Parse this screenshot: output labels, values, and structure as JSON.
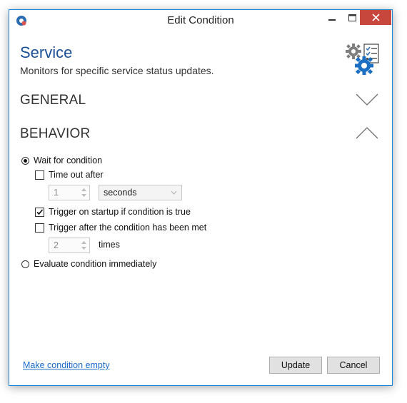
{
  "window": {
    "title": "Edit Condition"
  },
  "header": {
    "title": "Service",
    "subtitle": "Monitors for specific service status updates."
  },
  "sections": {
    "general": "GENERAL",
    "behavior": "BEHAVIOR"
  },
  "behavior": {
    "wait_for_condition": {
      "label": "Wait for condition",
      "selected": true
    },
    "time_out_after": {
      "label": "Time out after",
      "checked": false,
      "value": "1",
      "unit": "seconds"
    },
    "trigger_on_startup": {
      "label": "Trigger on startup if condition is true",
      "checked": true
    },
    "trigger_after_met": {
      "label": "Trigger after the condition has been met",
      "checked": false,
      "value": "2",
      "unit_label": "times"
    },
    "evaluate_immediately": {
      "label": "Evaluate condition immediately",
      "selected": false
    }
  },
  "footer": {
    "link": "Make condition empty",
    "update": "Update",
    "cancel": "Cancel"
  },
  "icons": {
    "app": "app-icon",
    "service": "service-gear-checklist-icon",
    "minimize": "minimize-icon",
    "maximize": "maximize-icon",
    "close": "close-icon"
  },
  "colors": {
    "accent": "#1b4f96",
    "border": "#1c86d4",
    "close": "#c8473d",
    "link": "#1a6bc9"
  }
}
